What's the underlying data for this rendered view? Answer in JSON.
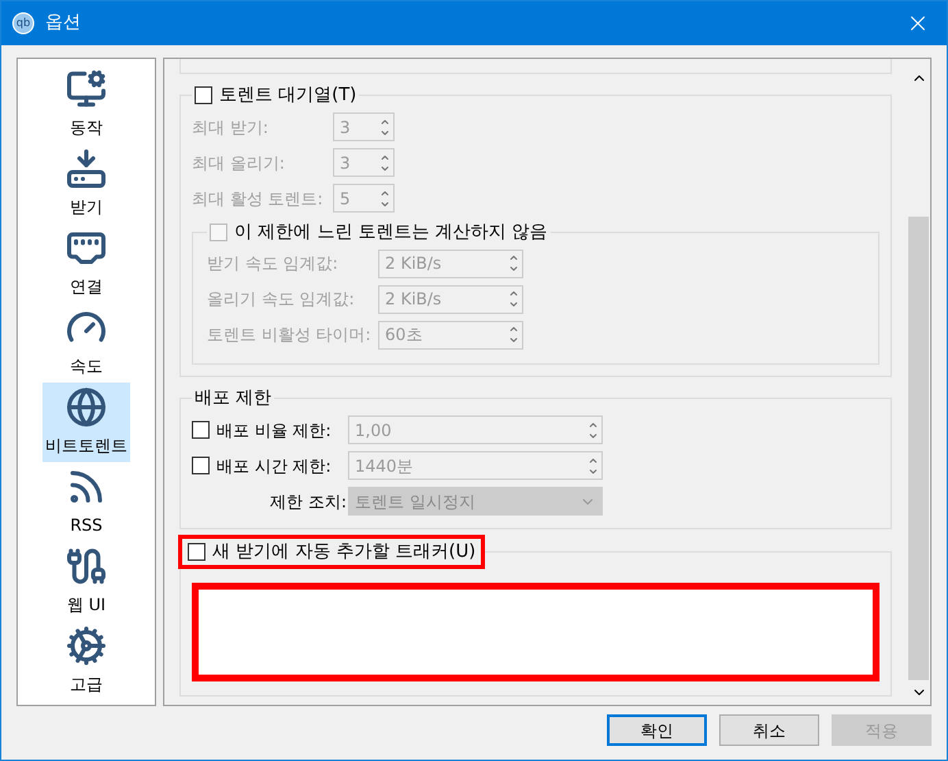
{
  "window": {
    "title": "옵션",
    "app_icon": "qb"
  },
  "sidebar": {
    "items": [
      {
        "label": "동작",
        "selected": false
      },
      {
        "label": "받기",
        "selected": false
      },
      {
        "label": "연결",
        "selected": false
      },
      {
        "label": "속도",
        "selected": false
      },
      {
        "label": "비트토렌트",
        "selected": true
      },
      {
        "label": "RSS",
        "selected": false
      },
      {
        "label": "웹 UI",
        "selected": false
      },
      {
        "label": "고급",
        "selected": false
      }
    ]
  },
  "queue": {
    "label": "토렌트 대기열(T)",
    "checked": false,
    "rows": [
      {
        "label": "최대 받기:",
        "value": "3",
        "disabled": true
      },
      {
        "label": "최대 올리기:",
        "value": "3",
        "disabled": true
      },
      {
        "label": "최대 활성 토렌트:",
        "value": "5",
        "disabled": true
      }
    ],
    "slow": {
      "label": "이 제한에 느린 토렌트는 계산하지 않음",
      "checked": false,
      "disabled": true,
      "rows": [
        {
          "label": "받기 속도 임계값:",
          "value": "2 KiB/s",
          "disabled": true
        },
        {
          "label": "올리기 속도 임계값:",
          "value": "2 KiB/s",
          "disabled": true
        },
        {
          "label": "토렌트 비활성 타이머:",
          "value": "60초",
          "disabled": true
        }
      ]
    }
  },
  "seeding": {
    "title": "배포 제한",
    "rows": [
      {
        "kind": "check",
        "label": "배포 비율 제한:",
        "checked": false,
        "value": "1,00",
        "disabled": true
      },
      {
        "kind": "check",
        "label": "배포 시간 제한:",
        "checked": false,
        "value": "1440분",
        "disabled": true
      },
      {
        "kind": "select",
        "label": "제한 조치:",
        "value": "토렌트 일시정지",
        "disabled": true
      }
    ]
  },
  "trackers": {
    "label": "새 받기에 자동 추가할 트래커(U)",
    "checked": false
  },
  "buttons": [
    {
      "label": "확인",
      "default": true,
      "disabled": false
    },
    {
      "label": "취소",
      "default": false,
      "disabled": false
    },
    {
      "label": "적용",
      "default": false,
      "disabled": true
    }
  ]
}
